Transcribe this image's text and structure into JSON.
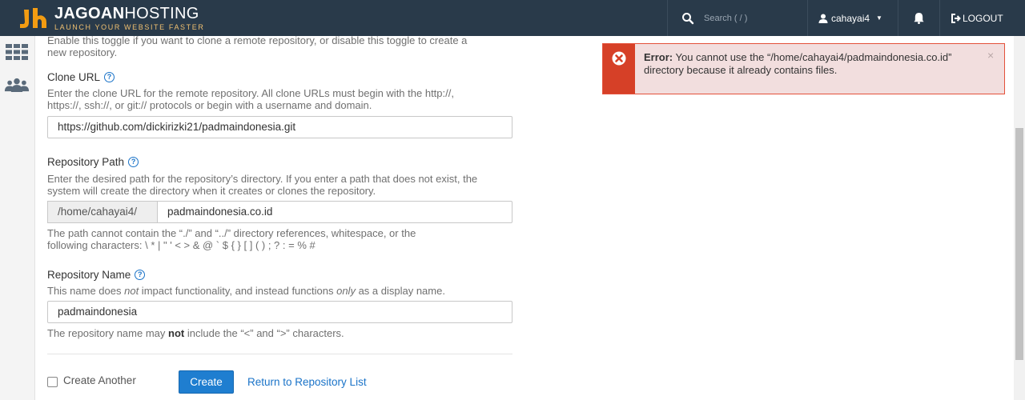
{
  "header": {
    "logo_main": "JAGOAN",
    "logo_accent": "HOSTING",
    "logo_tagline": "LAUNCH YOUR WEBSITE FASTER",
    "search_placeholder": "Search ( / )",
    "username": "cahayai4",
    "logout_label": "LOGOUT"
  },
  "form": {
    "toggle_help_line1": "Enable this toggle if you want to clone a remote repository, or disable this toggle to create a",
    "toggle_help_line2": "new repository.",
    "clone_url": {
      "label": "Clone URL",
      "help_line1": "Enter the clone URL for the remote repository. All clone URLs must begin with the http://,",
      "help_line2": "https://, ssh://, or git:// protocols or begin with a username and domain.",
      "value": "https://github.com/dickirizki21/padmaindonesia.git"
    },
    "repo_path": {
      "label": "Repository Path",
      "help_line1": "Enter the desired path for the repository’s directory. If you enter a path that does not exist, the",
      "help_line2": "system will create the directory when it creates or clones the repository.",
      "prefix": "/home/cahayai4/",
      "value": "padmaindonesia.co.id",
      "note_line1": "The path cannot contain the “./” and “../” directory references, whitespace, or the",
      "note_line2": "following characters: \\ * | \" ' < > & @ ` $ { } [ ] ( ) ; ? : = % #"
    },
    "repo_name": {
      "label": "Repository Name",
      "help_pre": "This name does ",
      "help_em1": "not",
      "help_mid": " impact functionality, and instead functions ",
      "help_em2": "only",
      "help_post": " as a display name.",
      "value": "padmaindonesia",
      "note_pre": "The repository name may ",
      "note_bold": "not",
      "note_post": " include the “<” and “>” characters."
    },
    "create_another_label": "Create Another",
    "create_another_checked": false,
    "create_button": "Create",
    "return_link": "Return to Repository List"
  },
  "alert": {
    "title": "Error:",
    "message": " You cannot use the “/home/cahayai4/padmaindonesia.co.id” directory because it already contains files.",
    "close": "×"
  },
  "colors": {
    "header_bg": "#293a4a",
    "accent_orange": "#f39c12",
    "primary_blue": "#1f7ed0",
    "error_red": "#d64027",
    "error_bg": "#f2dede"
  },
  "icons": {
    "sidebar": [
      "grid-icon",
      "users-icon"
    ],
    "header": [
      "search-icon",
      "user-icon",
      "bell-icon",
      "logout-icon"
    ]
  }
}
